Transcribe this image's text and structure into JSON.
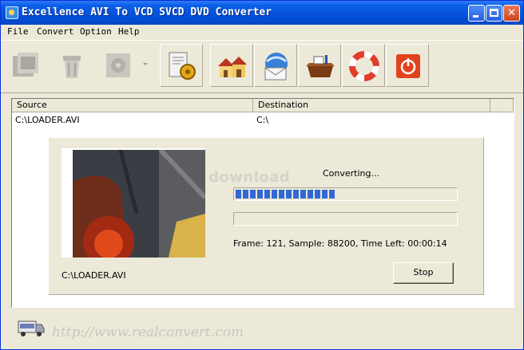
{
  "window": {
    "title": "Excellence AVI To VCD SVCD DVD Converter"
  },
  "title_buttons": {
    "minimize": "",
    "maximize": "",
    "close": "✕"
  },
  "menu": [
    {
      "label": "File"
    },
    {
      "label": "Convert"
    },
    {
      "label": "Option"
    },
    {
      "label": "Help"
    }
  ],
  "toolbar": [
    {
      "icon": "add-files-icon",
      "state": "disabled"
    },
    {
      "icon": "remove-file-icon",
      "state": "disabled"
    },
    {
      "icon": "convert-icon",
      "state": "disabled",
      "has_dropdown": true
    },
    {
      "icon": "settings-icon",
      "state": "enabled"
    },
    {
      "icon": "homepage-icon",
      "state": "enabled"
    },
    {
      "icon": "email-icon",
      "state": "enabled"
    },
    {
      "icon": "register-icon",
      "state": "enabled"
    },
    {
      "icon": "help-lifebuoy-icon",
      "state": "enabled"
    },
    {
      "icon": "exit-power-icon",
      "state": "enabled"
    }
  ],
  "file_list": {
    "columns": [
      "Source",
      "Destination"
    ],
    "rows": [
      {
        "source": "C:\\LOADER.AVI",
        "destination": "C:\\"
      }
    ]
  },
  "progress": {
    "watermark": "download",
    "status": "Converting...",
    "overall_progress": 0.47,
    "file_progress": 0.0,
    "stats": "Frame: 121, Sample: 88200, Time Left: 00:00:14",
    "current_file": "C:\\LOADER.AVI",
    "stop_label": "Stop"
  },
  "footer": {
    "url": "http://www.realconvert.com"
  },
  "colors": {
    "title_bar": "#0550d8",
    "progress_fill": "#3168d5",
    "window_bg": "#ece9d8"
  }
}
